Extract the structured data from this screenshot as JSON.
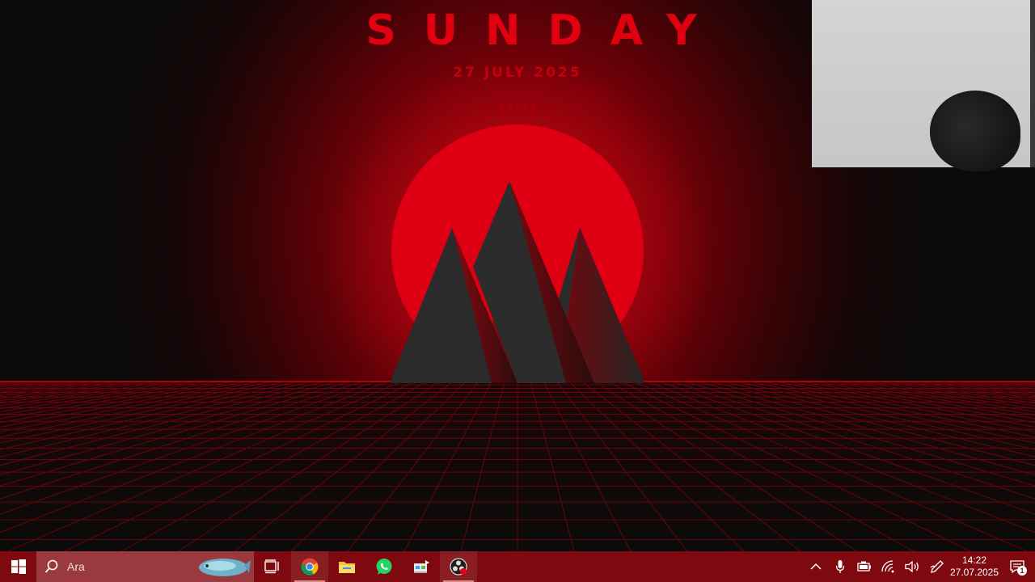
{
  "wallpaper": {
    "day": "SUNDAY",
    "date": "27 JULY 2025",
    "time": "14:22",
    "colors": {
      "sun": "#e00012",
      "accent": "#e0000f",
      "mountain": "#2b2b2b",
      "grid": "#c0000f"
    }
  },
  "webcam": {
    "label": "webcam-overlay"
  },
  "taskbar": {
    "background": "#7e0a10",
    "start_icon": "windows-logo-icon",
    "search": {
      "placeholder": "Ara",
      "icon": "search-icon"
    },
    "apps": [
      {
        "name": "task-view",
        "icon": "task-view-icon"
      },
      {
        "name": "chrome",
        "icon": "chrome-icon",
        "active": true
      },
      {
        "name": "file-explorer",
        "icon": "folder-icon"
      },
      {
        "name": "whatsapp",
        "icon": "whatsapp-icon"
      },
      {
        "name": "store",
        "icon": "store-icon"
      },
      {
        "name": "obs",
        "icon": "obs-icon",
        "active": true
      }
    ],
    "tray": {
      "icons": [
        "chevron-up-icon",
        "microphone-icon",
        "battery-icon",
        "wifi-icon",
        "volume-icon",
        "pen-icon"
      ],
      "clock_time": "14:22",
      "clock_date": "27.07.2025",
      "notification_count": "1"
    }
  }
}
